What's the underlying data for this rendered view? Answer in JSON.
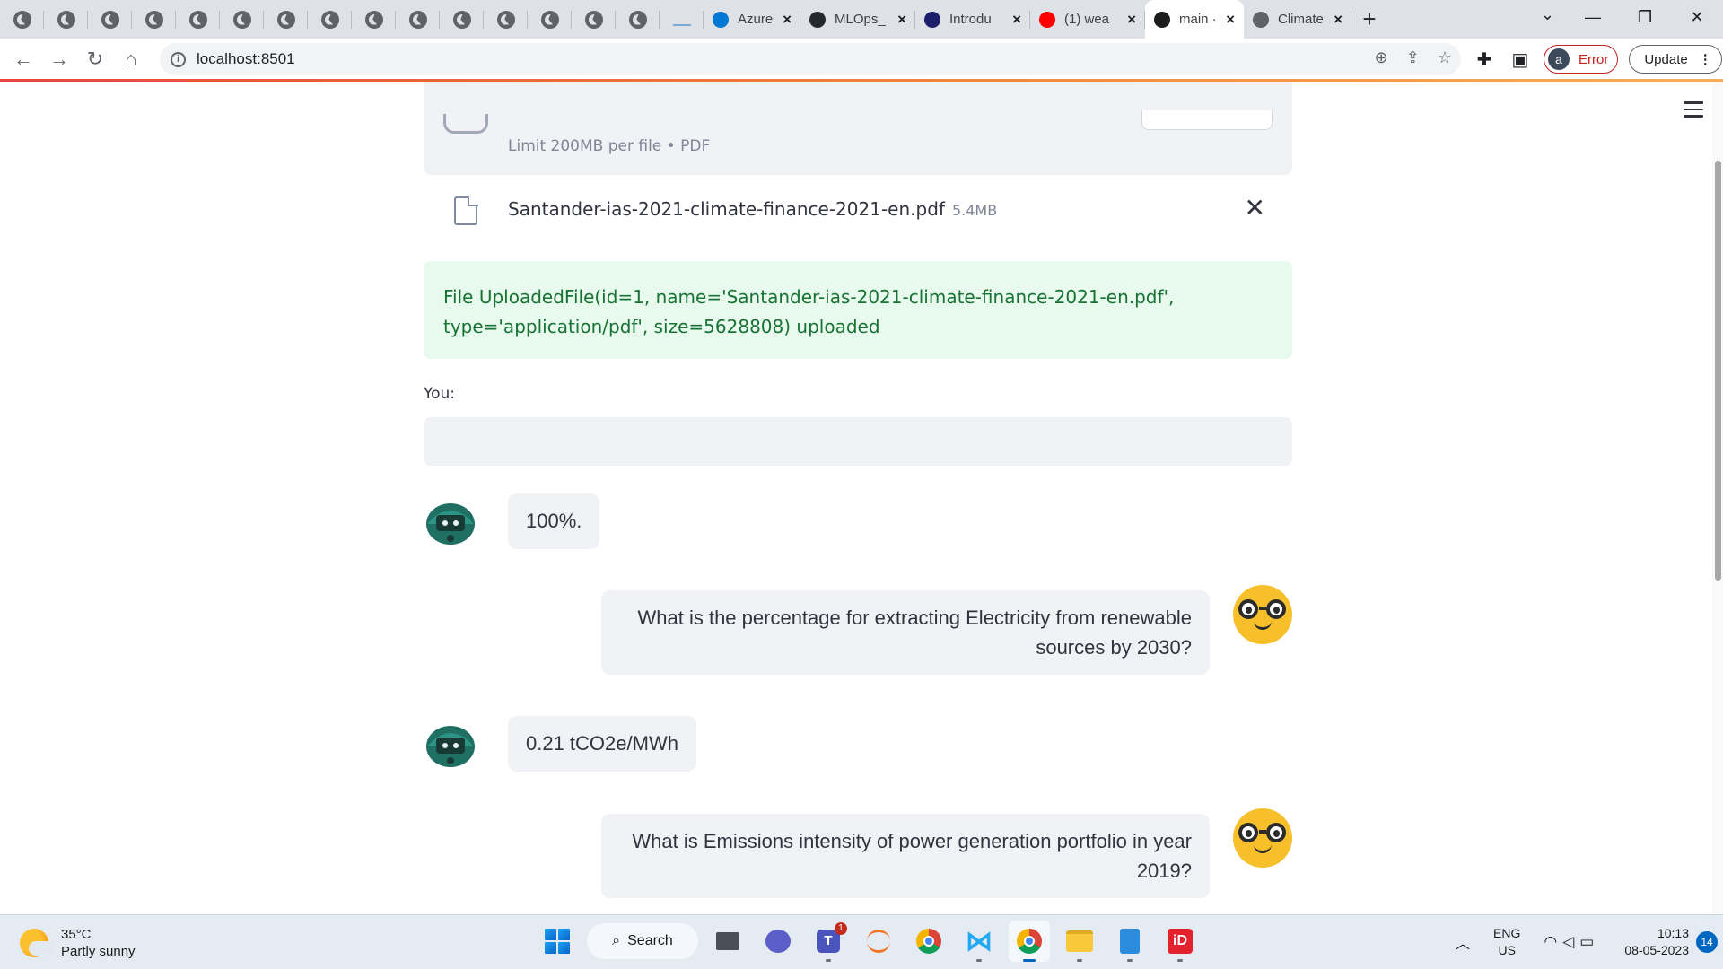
{
  "browser": {
    "tabs": [
      {
        "label": "Azure M",
        "color": "#0078d4"
      },
      {
        "label": "MLOps_",
        "color": "#24292f"
      },
      {
        "label": "Introdu",
        "color": "#1b1f6b"
      },
      {
        "label": "(1) wea",
        "color": "#ff0000"
      },
      {
        "label": "main · S",
        "color": "#1b1b1b",
        "active": true
      },
      {
        "label": "Climate",
        "color": "#5f6368"
      }
    ],
    "url": "localhost:8501",
    "profile_initial": "a",
    "profile_status": "Error",
    "update_label": "Update"
  },
  "uploader": {
    "limit_text": "Limit 200MB per file • PDF",
    "file_name": "Santander-ias-2021-climate-finance-2021-en.pdf",
    "file_size": "5.4MB"
  },
  "success_message": "File UploadedFile(id=1, name='Santander-ias-2021-climate-finance-2021-en.pdf', type='application/pdf', size=5628808) uploaded",
  "chat": {
    "input_label": "You:",
    "input_value": "",
    "messages": [
      {
        "role": "bot",
        "text": "100%."
      },
      {
        "role": "user",
        "text": "What is the percentage for extracting Electricity from renewable sources by 2030?"
      },
      {
        "role": "bot",
        "text": "0.21 tCO2e/MWh"
      },
      {
        "role": "user",
        "text": "What is Emissions intensity of power generation portfolio in year 2019?"
      }
    ]
  },
  "taskbar": {
    "temperature": "35°C",
    "weather": "Partly sunny",
    "search_label": "Search",
    "teams_badge": "1",
    "lang_primary": "ENG",
    "lang_secondary": "US",
    "time": "10:13",
    "date": "08-05-2023",
    "notifications": "14"
  }
}
